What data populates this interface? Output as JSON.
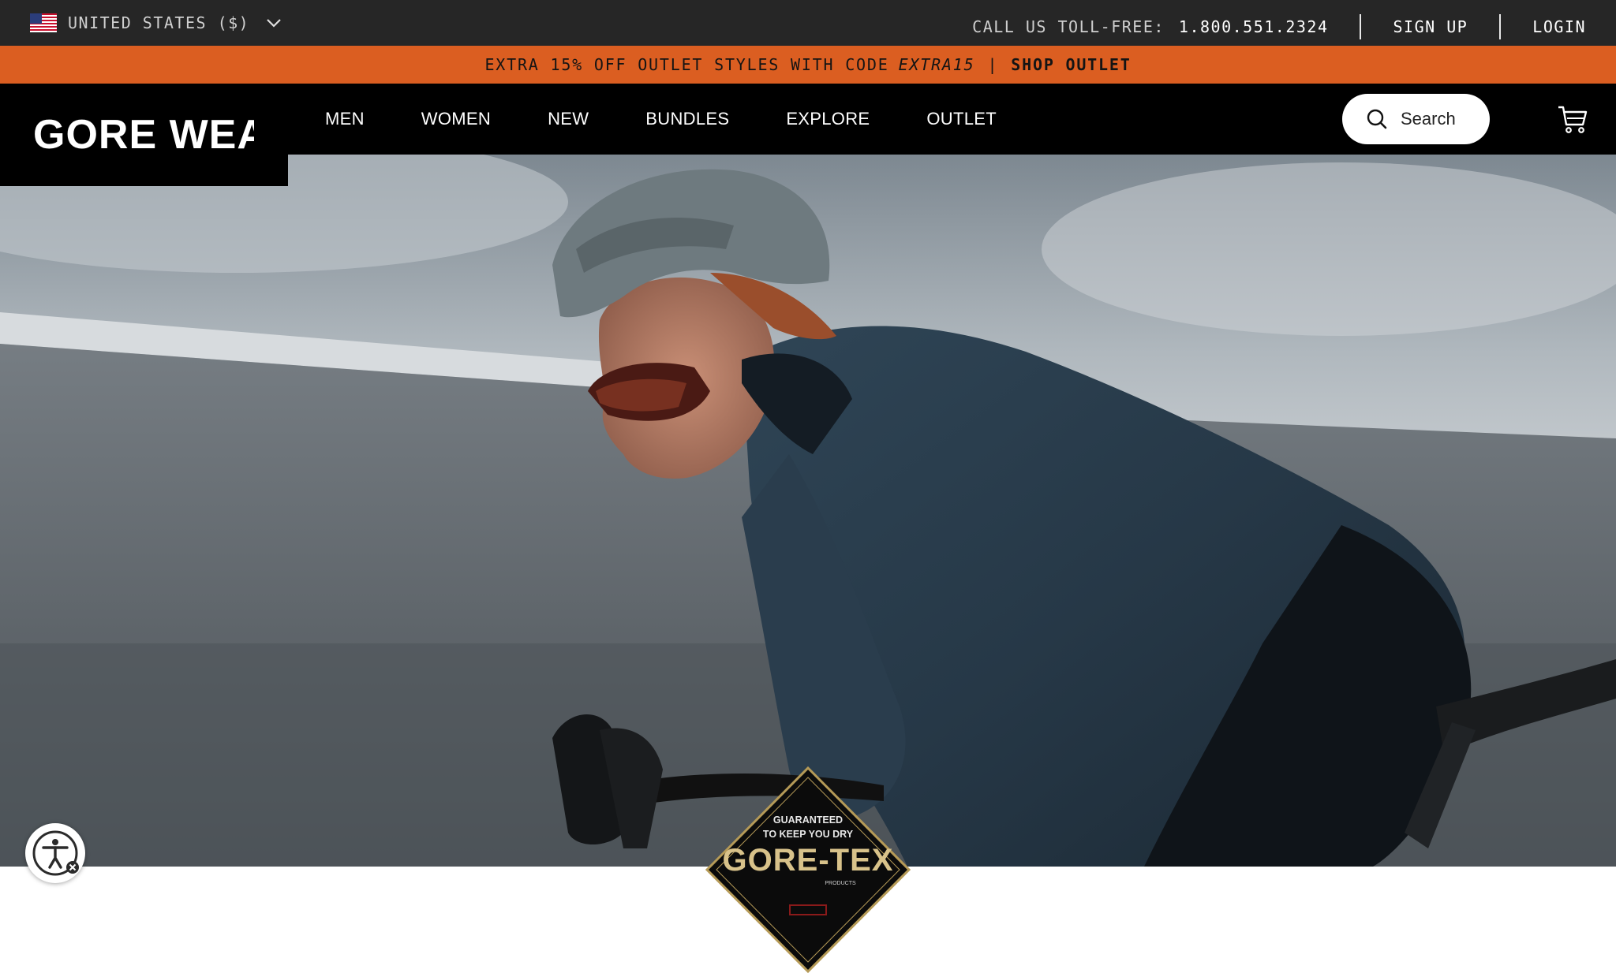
{
  "utility_bar": {
    "region_label": "UNITED STATES ($)",
    "call_label": "CALL US TOLL-FREE:",
    "phone": "1.800.551.2324",
    "signup": "SIGN UP",
    "login": "LOGIN"
  },
  "promo": {
    "text": "EXTRA 15% OFF OUTLET STYLES WITH CODE",
    "code": "EXTRA15",
    "separator": "|",
    "link": "SHOP OUTLET"
  },
  "header": {
    "logo": "GORE WEAR",
    "nav": [
      "MEN",
      "WOMEN",
      "NEW",
      "BUNDLES",
      "EXPLORE",
      "OUTLET"
    ],
    "search_label": "Search"
  },
  "badge": {
    "line1": "GUARANTEED",
    "line2": "TO KEEP YOU DRY",
    "brand": "GORE-TEX",
    "sub": "PRODUCTS"
  },
  "icons": {
    "flag": "us-flag-icon",
    "chevron": "chevron-down-icon",
    "search": "search-icon",
    "cart": "cart-icon",
    "accessibility": "accessibility-icon"
  },
  "colors": {
    "utility_bg": "#262626",
    "promo_bg": "#db5e21",
    "nav_bg": "#000000"
  }
}
